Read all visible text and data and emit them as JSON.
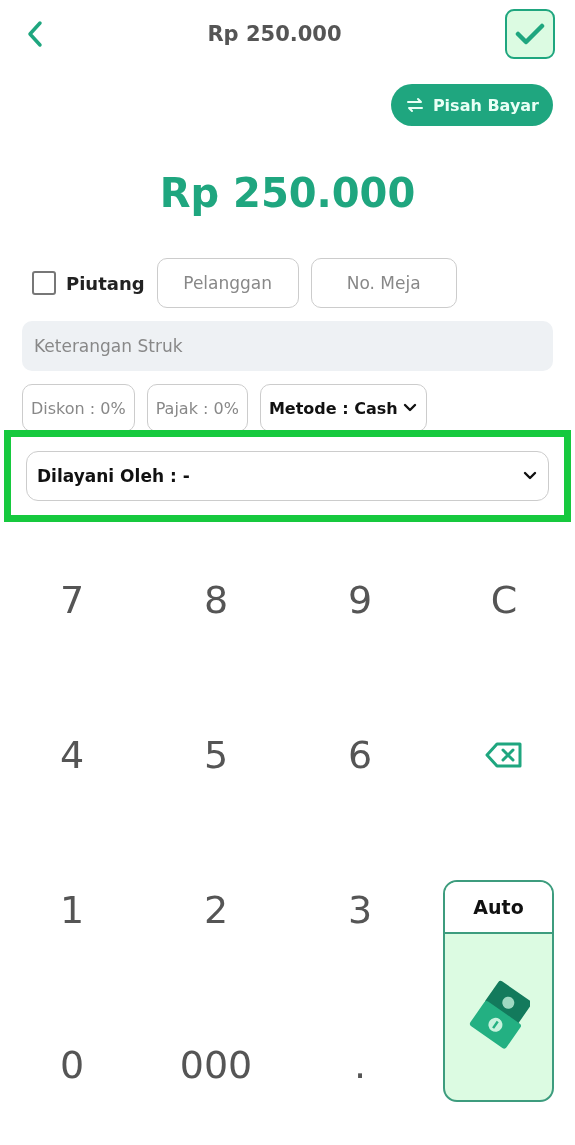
{
  "header": {
    "title": "Rp 250.000"
  },
  "split_button": {
    "label": "Pisah Bayar"
  },
  "total": "Rp 250.000",
  "credit": {
    "label": "Piutang",
    "checked": false
  },
  "customer": {
    "placeholder": "Pelanggan"
  },
  "table_no": {
    "placeholder": "No. Meja"
  },
  "receipt_note": {
    "placeholder": "Keterangan Struk"
  },
  "discount": {
    "label": "Diskon : 0%"
  },
  "tax": {
    "label": "Pajak : 0%"
  },
  "method": {
    "label": "Metode : Cash"
  },
  "served_by": {
    "label": "Dilayani Oleh : -",
    "highlighted": true
  },
  "keys": [
    {
      "kind": "digit",
      "label": "7"
    },
    {
      "kind": "digit",
      "label": "8"
    },
    {
      "kind": "digit",
      "label": "9"
    },
    {
      "kind": "clear",
      "label": "C"
    },
    {
      "kind": "digit",
      "label": "4"
    },
    {
      "kind": "digit",
      "label": "5"
    },
    {
      "kind": "digit",
      "label": "6"
    },
    {
      "kind": "backspace"
    },
    {
      "kind": "digit",
      "label": "1"
    },
    {
      "kind": "digit",
      "label": "2"
    },
    {
      "kind": "digit",
      "label": "3"
    },
    {
      "kind": "auto",
      "label": "Auto"
    },
    {
      "kind": "digit",
      "label": "0"
    },
    {
      "kind": "digit",
      "label": "000"
    },
    {
      "kind": "digit",
      "label": "."
    }
  ]
}
